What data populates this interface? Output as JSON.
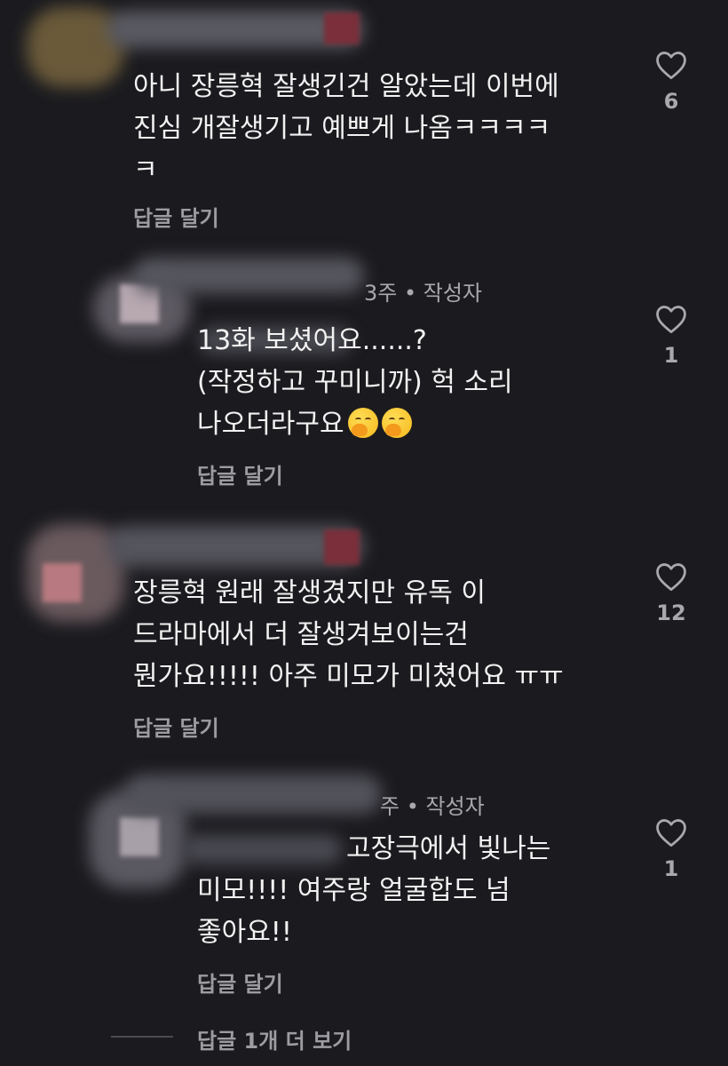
{
  "comments": [
    {
      "meta": "",
      "text": "아니 장릉혁 잘생긴건 알았는데 이번에\n진심 개잘생기고 예쁘게 나옴ㅋㅋㅋㅋ\nㅋ",
      "reply_label": "답글 달기",
      "likes": "6"
    },
    {
      "meta": "3주 • 작성자",
      "text": "13화 보셨어요......?\n(작정하고 꾸미니까) 헉 소리\n나오더라구요",
      "emojis": [
        "face-with-hand-over-mouth",
        "face-with-hand-over-mouth"
      ],
      "reply_label": "답글 달기",
      "likes": "1"
    },
    {
      "meta": "",
      "text": "장릉혁 원래 잘생겼지만 유독 이\n드라마에서 더 잘생겨보이는건\n뭔가요!!!!! 아주 미모가 미쳤어요 ㅠㅠ",
      "reply_label": "답글 달기",
      "likes": "12"
    },
    {
      "meta": "주 • 작성자",
      "text": "고장극에서 빛나는\n미모!!!! 여주랑 얼굴합도 넘\n좋아요!!",
      "reply_label": "답글 달기",
      "likes": "1"
    }
  ],
  "view_more_replies": "답글 1개 더 보기",
  "colors": {
    "background": "#1b1b1f",
    "text": "#f2f2f2",
    "secondary": "#a8a8ad"
  },
  "icons": [
    "heart-outline-icon"
  ]
}
